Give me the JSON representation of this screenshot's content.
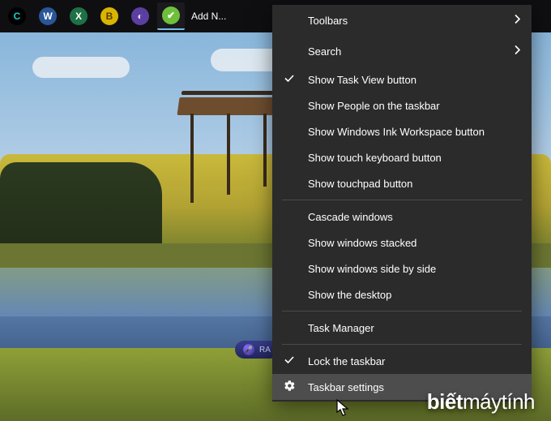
{
  "taskbar": {
    "items": [
      {
        "name": "app-coccoc",
        "glyph": "C",
        "bg": "#000",
        "fg": "#17d1c6"
      },
      {
        "name": "app-word",
        "glyph": "W",
        "bg": "#2a5699",
        "fg": "#fff"
      },
      {
        "name": "app-excel",
        "glyph": "X",
        "bg": "#1e7145",
        "fg": "#fff"
      },
      {
        "name": "app-b",
        "glyph": "B",
        "bg": "#d9b400",
        "fg": "#5a3b00"
      },
      {
        "name": "app-bird",
        "glyph": "◐",
        "bg": "#5b3fa0",
        "fg": "#e8d9ff"
      },
      {
        "name": "app-addnew",
        "glyph": "✔",
        "bg": "#6fbf3b",
        "fg": "#fff"
      }
    ],
    "active_label": "Add N..."
  },
  "menu": {
    "groups": [
      [
        {
          "label": "Toolbars",
          "submenu": true
        },
        {
          "label": "Search",
          "submenu": true
        },
        {
          "label": "Show Task View button",
          "checked": true
        },
        {
          "label": "Show People on the taskbar"
        },
        {
          "label": "Show Windows Ink Workspace button"
        },
        {
          "label": "Show touch keyboard button"
        },
        {
          "label": "Show touchpad button"
        }
      ],
      [
        {
          "label": "Cascade windows"
        },
        {
          "label": "Show windows stacked"
        },
        {
          "label": "Show windows side by side"
        },
        {
          "label": "Show the desktop"
        }
      ],
      [
        {
          "label": "Task Manager"
        }
      ],
      [
        {
          "label": "Lock the taskbar",
          "checked": true
        },
        {
          "label": "Taskbar settings",
          "icon": "gear",
          "hover": true
        }
      ]
    ]
  },
  "pill": {
    "label": "RA"
  },
  "watermark": {
    "bold": "biết",
    "rest1": "máy",
    "rest2": "tính"
  }
}
